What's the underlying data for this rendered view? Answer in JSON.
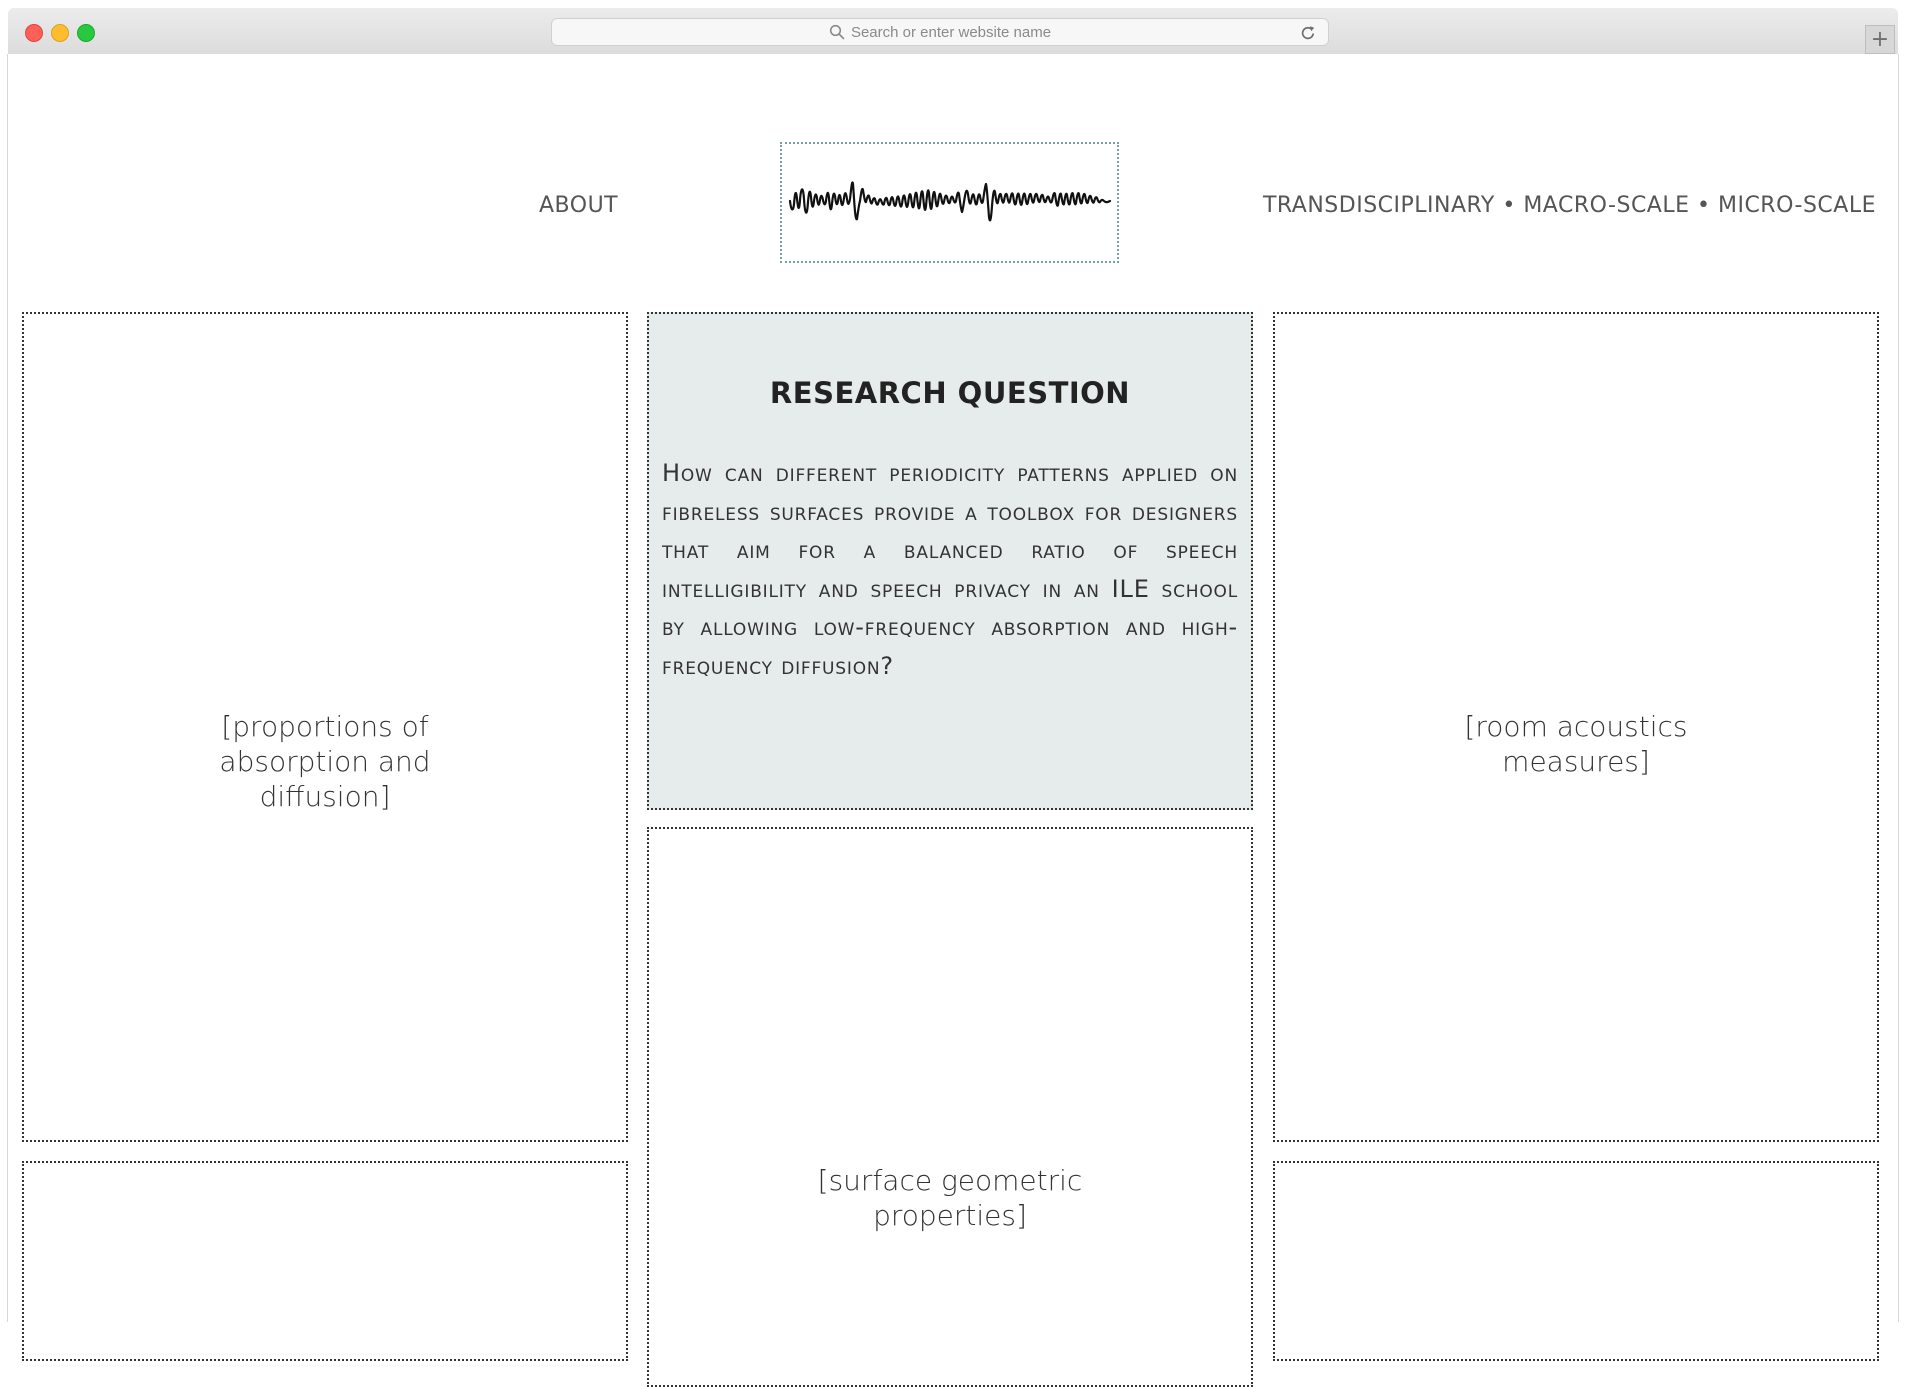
{
  "browser": {
    "address_placeholder": "Search or enter website name",
    "new_tab_label": "+"
  },
  "nav": {
    "about": "ABOUT",
    "scales": "TRANSDISCIPLINARY • MACRO-SCALE • MICRO-SCALE"
  },
  "cards": {
    "left_top": "[proportions of absorption and diffusion]",
    "right_top": "[room acoustics measures]",
    "center_bottom": "[surface geometric properties]"
  },
  "research": {
    "heading": "RESEARCH QUESTION",
    "question": "How can different periodicity patterns applied on fibreless surfaces provide a toolbox for designers that aim for a balanced ratio of speech intelligibility and speech privacy in an ILE school by allowing low-frequency absorption and high-frequency diffusion?"
  },
  "icons": {
    "search": "search-icon",
    "reload": "reload-icon",
    "logo": "waveform-logo"
  }
}
